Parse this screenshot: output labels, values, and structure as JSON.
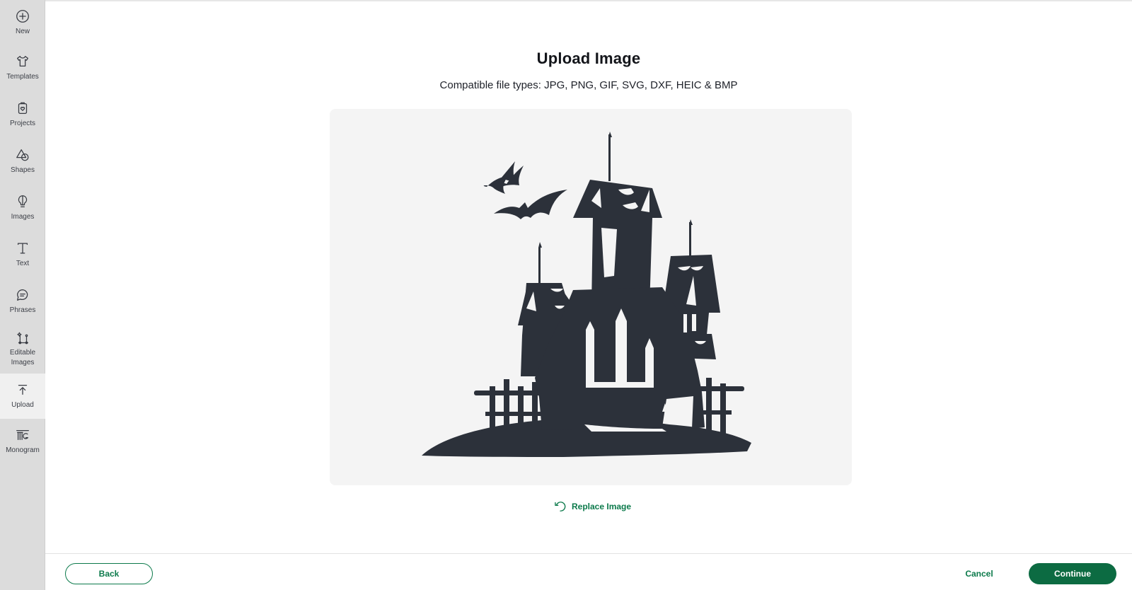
{
  "sidebar": {
    "items": [
      {
        "label": "New",
        "icon": "plus-circle-icon"
      },
      {
        "label": "Templates",
        "icon": "tshirt-icon"
      },
      {
        "label": "Projects",
        "icon": "clipboard-heart-icon"
      },
      {
        "label": "Shapes",
        "icon": "shapes-icon"
      },
      {
        "label": "Images",
        "icon": "lightbulb-icon"
      },
      {
        "label": "Text",
        "icon": "text-t-icon"
      },
      {
        "label": "Phrases",
        "icon": "speech-bubble-icon"
      },
      {
        "label": "Editable Images",
        "icon": "editable-image-icon"
      },
      {
        "label": "Upload",
        "icon": "upload-arrow-icon",
        "active": true
      },
      {
        "label": "Monogram",
        "icon": "monogram-icon"
      }
    ]
  },
  "main": {
    "title": "Upload Image",
    "subtitle": "Compatible file types:  JPG, PNG, GIF, SVG, DXF, HEIC & BMP",
    "replace_label": "Replace Image"
  },
  "footer": {
    "back_label": "Back",
    "cancel_label": "Cancel",
    "continue_label": "Continue"
  },
  "colors": {
    "accent": "#0c7a4b",
    "continue_bg": "#0c6b42",
    "silhouette": "#2c313a",
    "preview_bg": "#f4f4f4",
    "sidebar_bg": "#dcdcdc"
  }
}
